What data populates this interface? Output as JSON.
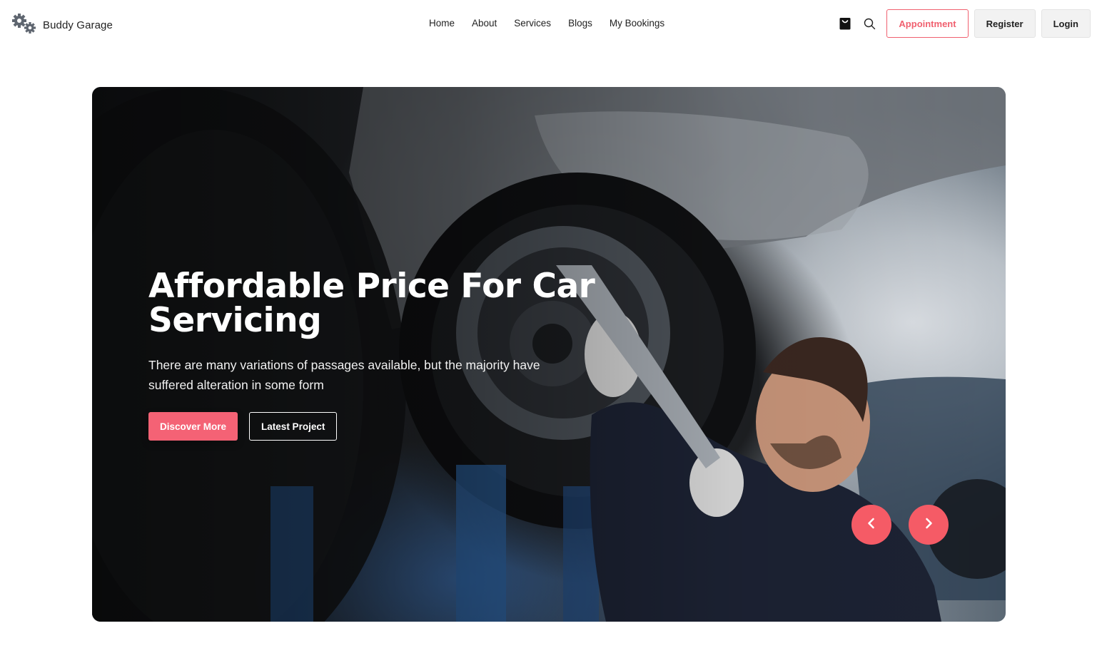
{
  "brand": {
    "name": "Buddy Garage",
    "icon": "gears-icon"
  },
  "nav": {
    "links": [
      {
        "label": "Home"
      },
      {
        "label": "About"
      },
      {
        "label": "Services"
      },
      {
        "label": "Blogs"
      },
      {
        "label": "My Bookings"
      }
    ],
    "icons": [
      "shopping-bag-icon",
      "search-icon"
    ],
    "appointment_label": "Appointment",
    "register_label": "Register",
    "login_label": "Login"
  },
  "hero": {
    "title": "Affordable Price For Car Servicing",
    "description": "There are many variations of passages available, but the majority have suffered alteration in some form",
    "primary_button": "Discover More",
    "secondary_button": "Latest Project",
    "prev_icon": "chevron-left-icon",
    "next_icon": "chevron-right-icon"
  },
  "colors": {
    "accent": "#f46275",
    "arrow": "#f55b66",
    "text": "#222222"
  }
}
